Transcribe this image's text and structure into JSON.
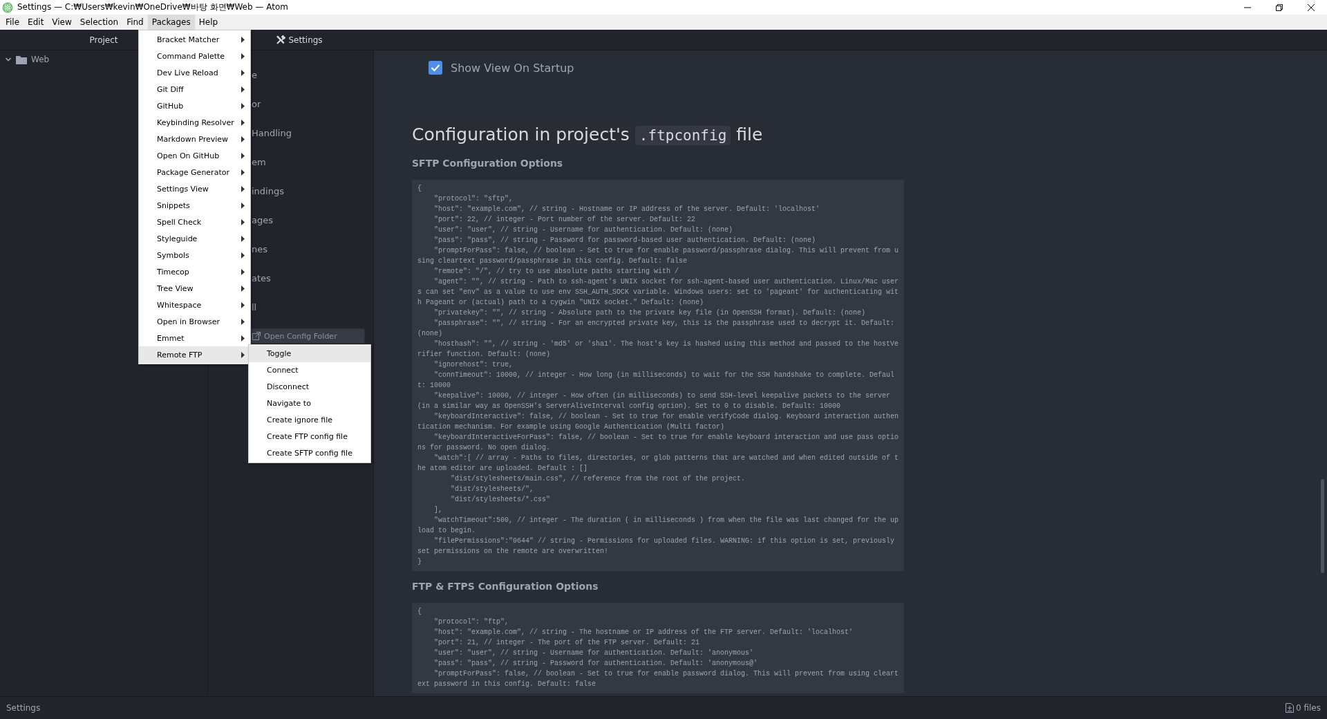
{
  "window": {
    "title": "Settings — C:₩Users₩kevin₩OneDrive₩바탕 화면₩Web — Atom"
  },
  "menu_bar": [
    {
      "label": "File",
      "selected": false
    },
    {
      "label": "Edit",
      "selected": false
    },
    {
      "label": "View",
      "selected": false
    },
    {
      "label": "Selection",
      "selected": false
    },
    {
      "label": "Find",
      "selected": false
    },
    {
      "label": "Packages",
      "selected": true
    },
    {
      "label": "Help",
      "selected": false
    }
  ],
  "packages_menu": {
    "items": [
      {
        "label": "Bracket Matcher",
        "selected": false
      },
      {
        "label": "Command Palette",
        "selected": false
      },
      {
        "label": "Dev Live Reload",
        "selected": false
      },
      {
        "label": "Git Diff",
        "selected": false
      },
      {
        "label": "GitHub",
        "selected": false
      },
      {
        "label": "Keybinding Resolver",
        "selected": false
      },
      {
        "label": "Markdown Preview",
        "selected": false
      },
      {
        "label": "Open On GitHub",
        "selected": false
      },
      {
        "label": "Package Generator",
        "selected": false
      },
      {
        "label": "Settings View",
        "selected": false
      },
      {
        "label": "Snippets",
        "selected": false
      },
      {
        "label": "Spell Check",
        "selected": false
      },
      {
        "label": "Styleguide",
        "selected": false
      },
      {
        "label": "Symbols",
        "selected": false
      },
      {
        "label": "Timecop",
        "selected": false
      },
      {
        "label": "Tree View",
        "selected": false
      },
      {
        "label": "Whitespace",
        "selected": false
      },
      {
        "label": "Open in Browser",
        "selected": false
      },
      {
        "label": "Emmet",
        "selected": false
      },
      {
        "label": "Remote FTP",
        "selected": true
      }
    ]
  },
  "submenu": {
    "items": [
      {
        "label": "Toggle",
        "selected": true
      },
      {
        "label": "Connect",
        "selected": false
      },
      {
        "label": "Disconnect",
        "selected": false
      },
      {
        "label": "Navigate to",
        "selected": false
      },
      {
        "label": "Create ignore file",
        "selected": false
      },
      {
        "label": "Create FTP config file",
        "selected": false
      },
      {
        "label": "Create SFTP config file",
        "selected": false
      }
    ]
  },
  "tree_view": {
    "title": "Project",
    "items": [
      {
        "label": "Web",
        "expanded": true
      }
    ]
  },
  "tabs": [
    {
      "label": "Settings",
      "selected": true
    }
  ],
  "settings_nav": {
    "items": [
      "e",
      "or",
      "Handling",
      "em",
      "indings",
      "ages",
      "nes",
      "ates",
      "ll"
    ],
    "button": "Open Config Folder"
  },
  "content": {
    "startup_option": {
      "label": "Show View On Startup",
      "checked": true
    },
    "heading": {
      "before": "Configuration in project's",
      "code": ".ftpconfig",
      "after": "file"
    },
    "sections": [
      {
        "title": "SFTP Configuration Options",
        "code_lines": [
          "{",
          "    \"protocol\": \"sftp\",",
          "    \"host\": \"example.com\", // string - Hostname or IP address of the server. Default: 'localhost'",
          "    \"port\": 22, // integer - Port number of the server. Default: 22",
          "    \"user\": \"user\", // string - Username for authentication. Default: (none)",
          "    \"pass\": \"pass\", // string - Password for password-based user authentication. Default: (none)",
          "    \"promptForPass\": false, // boolean - Set to true for enable password/passphrase dialog. This will prevent from using cleartext password/passphrase in this config. Default: false",
          "    \"remote\": \"/\", // try to use absolute paths starting with /",
          "    \"agent\": \"\", // string - Path to ssh-agent's UNIX socket for ssh-agent-based user authentication. Linux/Mac users can set \"env\" as a value to use env SSH_AUTH_SOCK variable. Windows users: set to 'pageant' for authenticating with Pageant or (actual) path to a cygwin \"UNIX socket.\" Default: (none)",
          "    \"privatekey\": \"\", // string - Absolute path to the private key file (in OpenSSH format). Default: (none)",
          "    \"passphrase\": \"\", // string - For an encrypted private key, this is the passphrase used to decrypt it. Default: (none)",
          "    \"hosthash\": \"\", // string - 'md5' or 'sha1'. The host's key is hashed using this method and passed to the hostVerifier function. Default: (none)",
          "    \"ignorehost\": true,",
          "    \"connTimeout\": 10000, // integer - How long (in milliseconds) to wait for the SSH handshake to complete. Default: 10000",
          "    \"keepalive\": 10000, // integer - How often (in milliseconds) to send SSH-level keepalive packets to the server (in a similar way as OpenSSH's ServerAliveInterval config option). Set to 0 to disable. Default: 10000",
          "    \"keyboardInteractive\": false, // boolean - Set to true for enable verifyCode dialog. Keyboard interaction authentication mechanism. For example using Google Authentication (Multi factor)",
          "    \"keyboardInteractiveForPass\": false, // boolean - Set to true for enable keyboard interaction and use pass options for password. No open dialog.",
          "    \"watch\":[ // array - Paths to files, directories, or glob patterns that are watched and when edited outside of the atom editor are uploaded. Default : []",
          "        \"dist/stylesheets/main.css\", // reference from the root of the project.",
          "        \"dist/stylesheets/\",",
          "        \"dist/stylesheets/*.css\"",
          "    ],",
          "    \"watchTimeout\":500, // integer - The duration ( in milliseconds ) from when the file was last changed for the upload to begin.",
          "    \"filePermissions\":\"0644\" // string - Permissions for uploaded files. WARNING: if this option is set, previously set permissions on the remote are overwritten!",
          "}"
        ]
      },
      {
        "title": "FTP & FTPS Configuration Options",
        "code_lines": [
          "{",
          "    \"protocol\": \"ftp\",",
          "    \"host\": \"example.com\", // string - The hostname or IP address of the FTP server. Default: 'localhost'",
          "    \"port\": 21, // integer - The port of the FTP server. Default: 21",
          "    \"user\": \"user\", // string - Username for authentication. Default: 'anonymous'",
          "    \"pass\": \"pass\", // string - Password for authentication. Default: 'anonymous@'",
          "    \"promptForPass\": false, // boolean - Set to true for enable password dialog. This will prevent from using cleartext password in this config. Default: false"
        ]
      }
    ]
  },
  "status_bar": {
    "left": "Settings",
    "right": "0 files"
  }
}
